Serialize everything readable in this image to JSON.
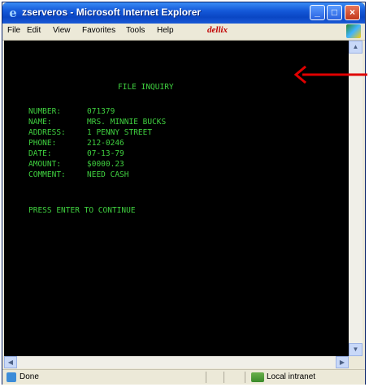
{
  "window": {
    "title": "zserveros - Microsoft Internet Explorer"
  },
  "menu": {
    "items": [
      "File",
      "Edit",
      "View",
      "Favorites",
      "Tools",
      "Help"
    ],
    "logo": "dellix"
  },
  "terminal": {
    "heading": "FILE INQUIRY",
    "fields": [
      {
        "label": "NUMBER:",
        "value": "071379"
      },
      {
        "label": "NAME:",
        "value": "MRS. MINNIE BUCKS"
      },
      {
        "label": "ADDRESS:",
        "value": "1 PENNY STREET"
      },
      {
        "label": "PHONE:",
        "value": "212-0246"
      },
      {
        "label": "DATE:",
        "value": "07-13-79"
      },
      {
        "label": "AMOUNT:",
        "value": "$0000.23"
      },
      {
        "label": "COMMENT:",
        "value": "NEED CASH"
      }
    ],
    "prompt": "PRESS ENTER TO CONTINUE"
  },
  "status": {
    "text": "Done",
    "zone": "Local intranet"
  },
  "colors": {
    "terminal_text": "#3fcf3f",
    "terminal_bg": "#000000",
    "annotation_arrow": "#e00000"
  }
}
